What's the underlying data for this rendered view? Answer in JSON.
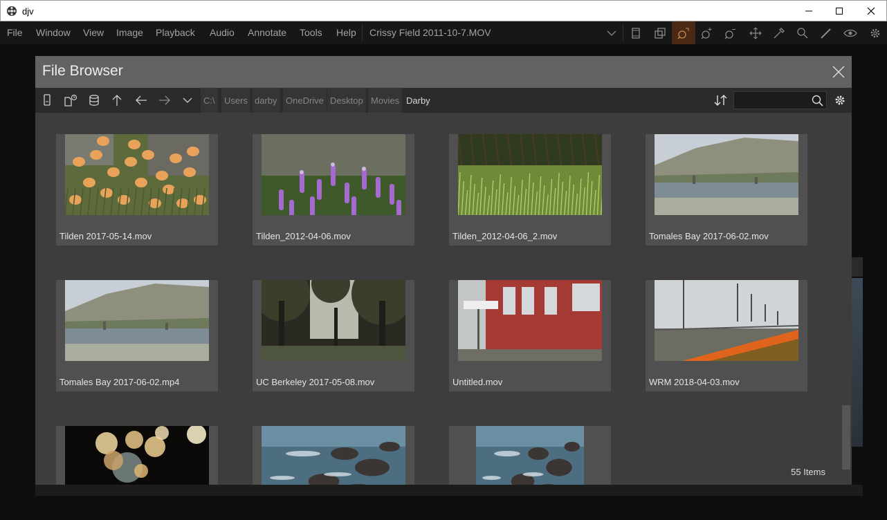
{
  "window": {
    "title": "djv"
  },
  "menu": {
    "items": [
      "File",
      "Window",
      "View",
      "Image",
      "Playback",
      "Audio",
      "Annotate",
      "Tools",
      "Help"
    ],
    "current_file": "Crissy Field 2011-10-7.MOV"
  },
  "toolbar": {
    "icons": [
      "fullscreen-icon",
      "window-layout-icon",
      "zoom-fit-icon",
      "zoom-in-icon",
      "zoom-out-icon",
      "pan-icon",
      "color-picker-icon",
      "magnify-icon",
      "annotate-pen-icon",
      "view-eye-icon",
      "settings-gear-icon"
    ]
  },
  "file_browser": {
    "title": "File Browser",
    "path": [
      "C:\\",
      "Users",
      "darby",
      "OneDrive",
      "Desktop",
      "Movies",
      "Darby"
    ],
    "search": {
      "value": "",
      "placeholder": ""
    },
    "item_count": "55 Items",
    "items": [
      {
        "name": "Tilden 2017-05-14.mov",
        "thumb": "poppies"
      },
      {
        "name": "Tilden_2012-04-06.mov",
        "thumb": "lupine"
      },
      {
        "name": "Tilden_2012-04-06_2.mov",
        "thumb": "grass"
      },
      {
        "name": "Tomales Bay 2017-06-02.mov",
        "thumb": "bay"
      },
      {
        "name": "Tomales Bay 2017-06-02.mp4",
        "thumb": "bay"
      },
      {
        "name": "UC Berkeley 2017-05-08.mov",
        "thumb": "trees"
      },
      {
        "name": "Untitled.mov",
        "thumb": "train"
      },
      {
        "name": "WRM 2018-04-03.mov",
        "thumb": "field"
      },
      {
        "name": "",
        "thumb": "bokeh"
      },
      {
        "name": "",
        "thumb": "water"
      },
      {
        "name": "",
        "thumb": "water"
      }
    ]
  },
  "colors": {
    "accent": "#e07a1f",
    "header": "#626262",
    "panel": "#3d3d3d",
    "tile": "#505050"
  }
}
